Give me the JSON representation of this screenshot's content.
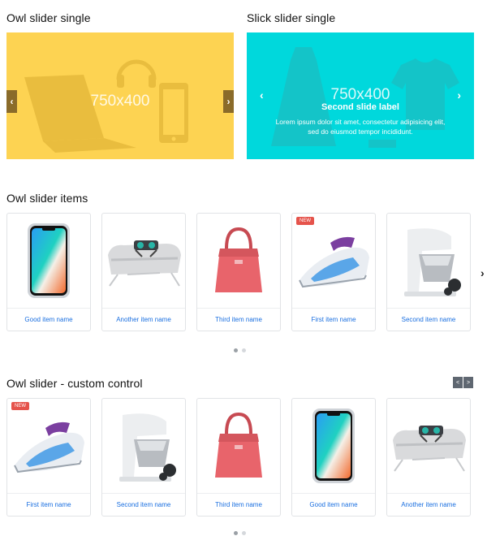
{
  "colors": {
    "yellow": "#fdd352",
    "cyan": "#00d8dc",
    "link": "#1a6fe0",
    "badge": "#e5534b"
  },
  "owl_single": {
    "title": "Owl slider single",
    "placeholder": "750x400",
    "prev_icon": "chevron-left-icon",
    "next_icon": "chevron-right-icon",
    "prev": "‹",
    "next": "›"
  },
  "slick_single": {
    "title": "Slick slider single",
    "placeholder": "750x400",
    "caption_title": "Second slide label",
    "caption_text": "Lorem ipsum dolor sit amet, consectetur adipisicing elit, sed do eiusmod tempor incididunt.",
    "prev": "‹",
    "next": "›"
  },
  "owl_items": {
    "title": "Owl slider items",
    "next": "›",
    "items": [
      {
        "name": "Good item name",
        "image": "phone",
        "badge": ""
      },
      {
        "name": "Another item name",
        "image": "tray",
        "badge": ""
      },
      {
        "name": "Third item name",
        "image": "bag",
        "badge": ""
      },
      {
        "name": "First item name",
        "image": "iron",
        "badge": "NEW"
      },
      {
        "name": "Second item name",
        "image": "mixer",
        "badge": ""
      }
    ]
  },
  "owl_custom": {
    "title": "Owl slider - custom control",
    "prev": "<",
    "next": ">",
    "items": [
      {
        "name": "First item name",
        "image": "iron",
        "badge": "NEW"
      },
      {
        "name": "Second item name",
        "image": "mixer",
        "badge": ""
      },
      {
        "name": "Third item name",
        "image": "bag",
        "badge": ""
      },
      {
        "name": "Good item name",
        "image": "phone",
        "badge": ""
      },
      {
        "name": "Another item name",
        "image": "tray",
        "badge": ""
      }
    ]
  }
}
